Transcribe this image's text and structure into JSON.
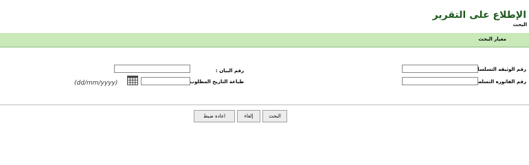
{
  "header": {
    "title": "الإطلاع على التقرير",
    "subtitle": "البحث"
  },
  "criteria": {
    "section_label": "معيار البحث",
    "fields": {
      "document_serial": {
        "label": "رقم الوثيقه التسلسلي :",
        "value": ""
      },
      "invoice_serial": {
        "label": "رقم الفاتوره التسلسلي :",
        "value": ""
      },
      "statement_number": {
        "label": "رقم البيان :",
        "value": ""
      },
      "print_date": {
        "label": "طباعة التاريخ المطلوب :",
        "value": "",
        "format_hint": "(dd/mm/yyyy)"
      }
    }
  },
  "actions": {
    "search_label": "البحث",
    "cancel_label": "إلغاء",
    "reset_label": "اعادة ضبط"
  },
  "icons": {
    "date_picker": "calendar-icon"
  },
  "colors": {
    "title": "#1e5a1e",
    "section_bar": "#c9e9b9",
    "section_border": "#8fbf7d",
    "button_bg": "#ececec"
  }
}
